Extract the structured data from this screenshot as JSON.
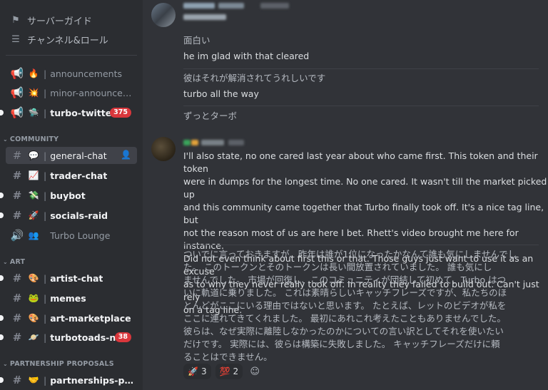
{
  "sidebar": {
    "top_items": [
      {
        "label": "サーバーガイド",
        "icon": "server-guide-icon"
      },
      {
        "label": "チャンネル&ロール",
        "icon": "channels-roles-icon"
      }
    ],
    "channels_top": [
      {
        "name": "announcements",
        "emoji": "🔥",
        "kind": "announcement"
      },
      {
        "name": "minor-announcem...",
        "emoji": "💥",
        "kind": "announcement"
      },
      {
        "name": "turbo-twitter",
        "emoji": "🛸",
        "kind": "announcement",
        "badge": "375"
      }
    ],
    "categories": {
      "community": "COMMUNITY",
      "art": "ART",
      "partnership": "PARTNERSHIP PROPOSALS"
    },
    "community_channels": [
      {
        "name": "general-chat",
        "emoji": "💬"
      },
      {
        "name": "trader-chat",
        "emoji": "📈"
      },
      {
        "name": "buybot",
        "emoji": "💸"
      },
      {
        "name": "socials-raid",
        "emoji": "🚀"
      },
      {
        "name": "Turbo Lounge",
        "emoji": "👥"
      }
    ],
    "art_channels": [
      {
        "name": "artist-chat",
        "emoji": "🎨"
      },
      {
        "name": "memes",
        "emoji": "🐸"
      },
      {
        "name": "art-marketplace",
        "emoji": "🎨"
      },
      {
        "name": "turbotoads-nft",
        "emoji": "🪐",
        "badge": "38"
      }
    ],
    "partnership_channels": [
      {
        "name": "partnerships-prop...",
        "emoji": "🤝"
      }
    ]
  },
  "chat": {
    "messages_a": [
      {
        "ja": "面白い",
        "en": "he im glad with that cleared"
      },
      {
        "ja": "彼はそれが解消されてうれしいです",
        "en": "turbo all the way"
      },
      {
        "ja": "ずっとターボ"
      }
    ],
    "message_b": {
      "en_lines": [
        "I'll also state, no one cared last year about who came first.  This token and their token",
        "were in dumps for the longest time.  No one cared.  It wasn't till the market picked up",
        "and this community came together that Turbo finally took off.  It's a nice tag line, but",
        "not the reason most of us are here I bet.  Rhett's video brought me here for instance.",
        "Did not even think about first this or that.  Those guys just want to use it as an excuse",
        "as to why they never really took off.  In reality they failed to build out.  Can't just rely",
        "on a tag line."
      ],
      "ja_lines": [
        "ついでに言っておきますが、昨年は誰が1位になったかなんて誰も気にしませんでし",
        "た。 このトークンとそのトークンは長い間放置されていました。 誰も気にし",
        "ませんでした。 市場が回復し、このコミュニティが団結して初めて、Turbo はつ",
        "いに軌道に乗りました。 これは素晴らしいキャッチフレーズですが、私たちのほ",
        "とんどがここにいる理由ではないと思います。 たとえば、レットのビデオが私を",
        "ここに連れてきてくれました。 最初にあれこれ考えたこともありませんでした。",
        " 彼らは、なぜ実際に離陸しなかったのかについての言い訳としてそれを使いたい",
        "だけです。 実際には、彼らは構築に失敗しました。 キャッチフレーズだけに頼",
        "ることはできません。"
      ],
      "reactions": [
        {
          "icon": "rocket-toad-icon",
          "glyph": "🚀",
          "count": "3"
        },
        {
          "icon": "hundred-icon",
          "glyph": "💯",
          "count": "2"
        }
      ]
    }
  }
}
